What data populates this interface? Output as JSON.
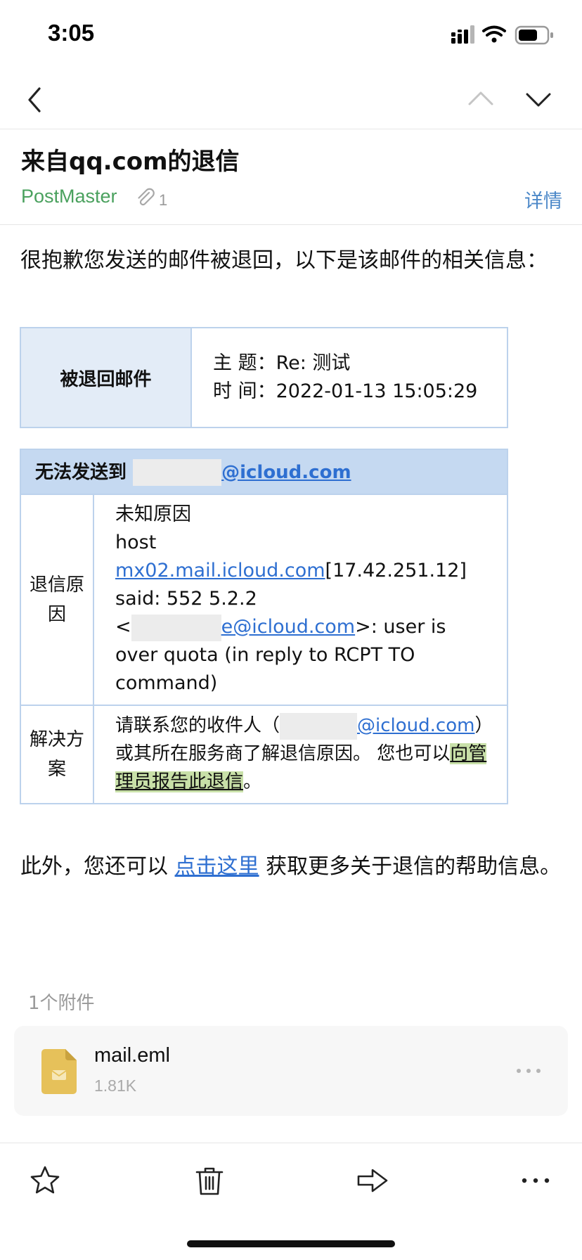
{
  "status_bar": {
    "time": "3:05"
  },
  "email": {
    "subject": "来自qq.com的退信",
    "sender": "PostMaster",
    "attachment_count": "1",
    "details_label": "详情",
    "intro": "很抱歉您发送的邮件被退回，以下是该邮件的相关信息：",
    "returned_mail": {
      "header": "被退回邮件",
      "subject_label": "主 题：",
      "subject_value": "Re: 测试",
      "time_label": "时 间：",
      "time_value": "2022-01-13 15:05:29"
    },
    "delivery_failure": {
      "header_prefix": "无法发送到",
      "header_email_domain": "@icloud.com",
      "reason_label": "退信原因",
      "reason_line1": "未知原因",
      "reason_host_word": "host",
      "reason_host_link": "mx02.mail.icloud.com",
      "reason_host_ip": "[17.42.251.12]",
      "reason_said": "said: 552 5.2.2",
      "reason_lt": "<",
      "reason_email_partial": "e@icloud.com",
      "reason_rest": ">: user is over quota (in reply to RCPT TO command)",
      "solution_label": "解决方案",
      "solution_prefix": "请联系您的收件人（",
      "solution_email_partial": "@icloud.com",
      "solution_middle": "）或其所在服务商了解退信原因。 您也可以",
      "solution_report_link": "向管理员报告此退信",
      "solution_suffix": "。"
    },
    "footer_prefix": "此外，您还可以 ",
    "footer_link": "点击这里",
    "footer_suffix": " 获取更多关于退信的帮助信息。"
  },
  "attachments": {
    "label": "1个附件",
    "files": [
      {
        "name": "mail.eml",
        "size": "1.81K"
      }
    ]
  },
  "colors": {
    "accent_green": "#4aa15e",
    "link_blue": "#2e6fd1",
    "detail_blue": "#4c88c8",
    "table_border": "#bcd2ec",
    "table_header_bg": "#e3ecf7",
    "failure_header_bg": "#c5d9f1",
    "highlight_green": "#c8e0a8",
    "file_icon_yellow": "#e6c15a"
  },
  "icons": {
    "back": "chevron-left-icon",
    "prev": "chevron-up-icon",
    "next": "chevron-down-icon",
    "attachment": "paperclip-icon",
    "file": "mail-file-icon",
    "file_more": "more-horizontal-icon",
    "star": "star-icon",
    "delete": "trash-icon",
    "forward": "forward-arrow-icon",
    "more": "more-horizontal-icon"
  }
}
